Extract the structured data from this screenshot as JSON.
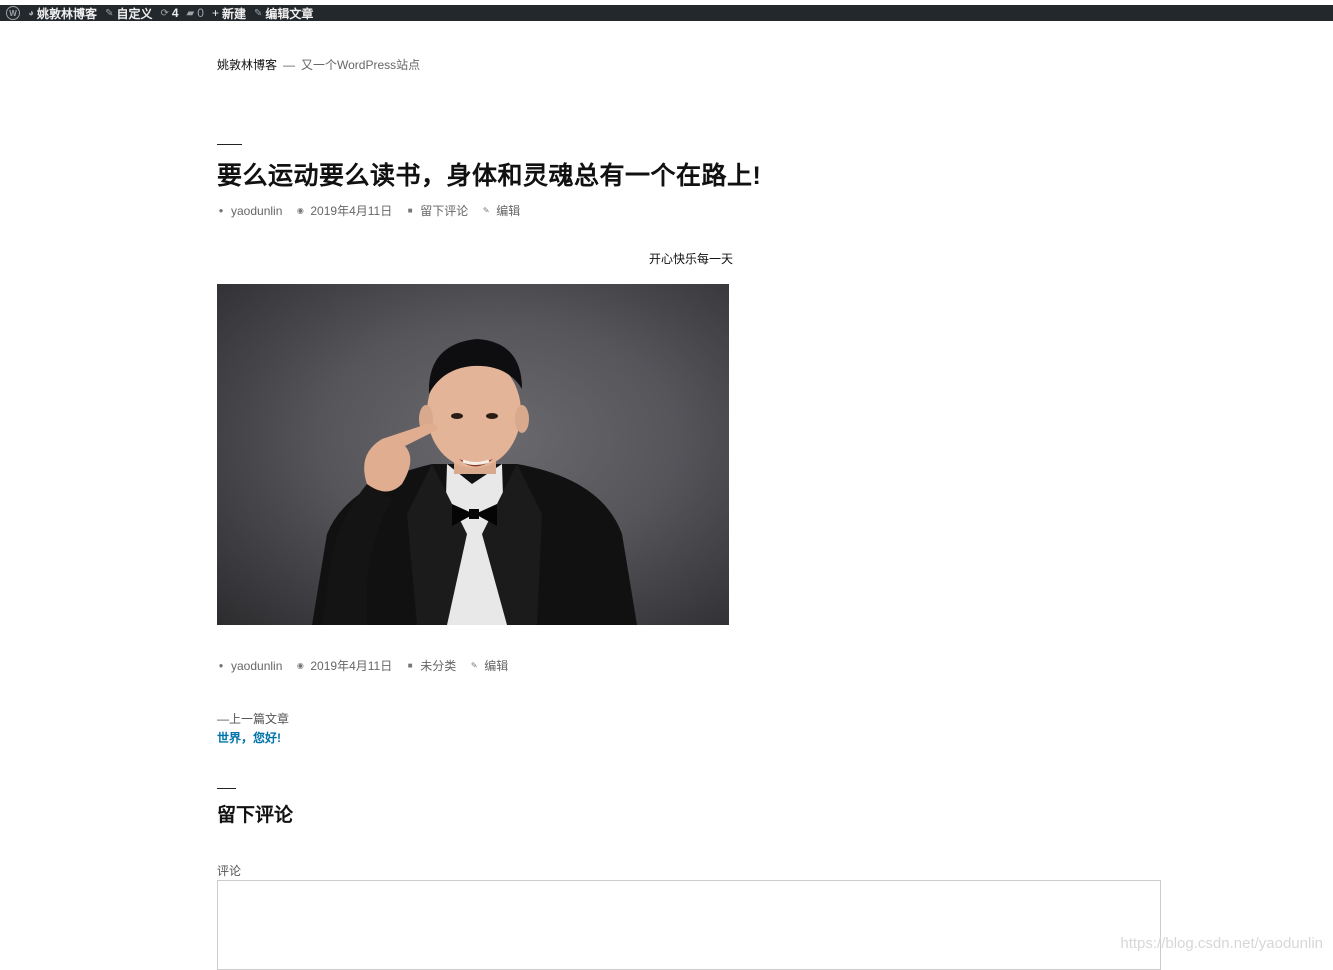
{
  "admin_bar": {
    "site_name": "姚敦林博客",
    "customize": "自定义",
    "updates_count": "4",
    "comments_count": "0",
    "new_label": "新建",
    "edit_post": "编辑文章"
  },
  "site": {
    "title": "姚敦林博客",
    "separator": "—",
    "description": "又一个WordPress站点"
  },
  "post": {
    "title": "要么运动要么读书，身体和灵魂总有一个在路上!",
    "meta_top": {
      "author": "yaodunlin",
      "date": "2019年4月11日",
      "comments": "留下评论",
      "edit": "编辑"
    },
    "image_caption": "开心快乐每一天",
    "meta_bottom": {
      "author": "yaodunlin",
      "date": "2019年4月11日",
      "category": "未分类",
      "edit": "编辑"
    }
  },
  "navigation": {
    "prev_label": "—上一篇文章",
    "prev_title": "世界，您好!"
  },
  "comments": {
    "title": "留下评论",
    "field_label": "评论"
  },
  "watermark": "https://blog.csdn.net/yaodunlin",
  "colors": {
    "admin_bar_bg": "#23282d",
    "link": "#0073aa"
  }
}
